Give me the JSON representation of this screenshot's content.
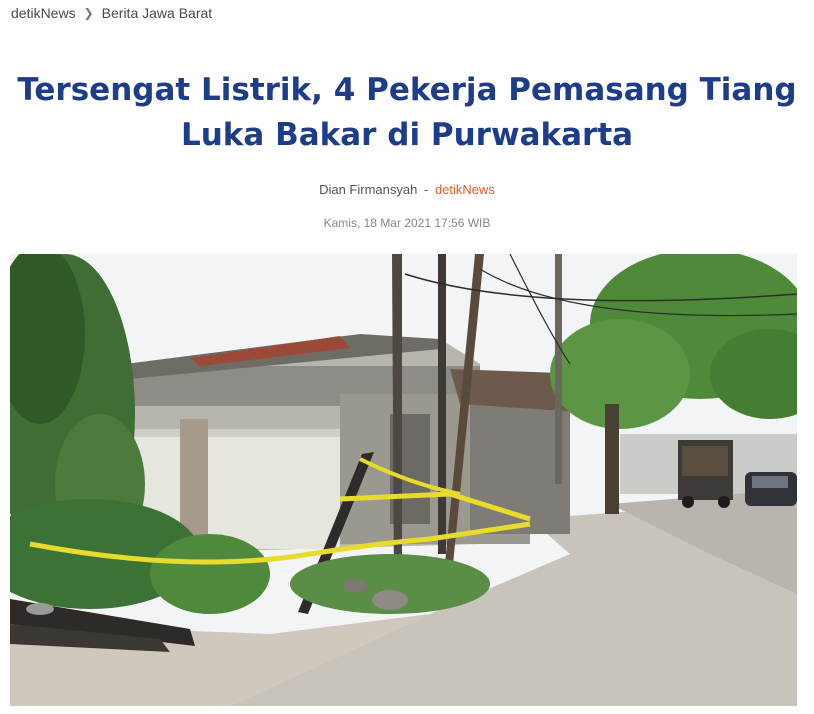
{
  "breadcrumb": {
    "items": [
      "detikNews",
      "Berita Jawa Barat"
    ],
    "separator_icon": "chevron-right-icon"
  },
  "article": {
    "title_line1": "Tersengat Listrik, 4 Pekerja Pemasang Tiang",
    "title_line2": "Luka Bakar di Purwakarta",
    "author": "Dian Firmansyah",
    "byline_separator": "-",
    "source": "detikNews",
    "date": "Kamis, 18 Mar 2021 17:56 WIB"
  },
  "colors": {
    "title": "#1d3d8a",
    "source": "#e25a29",
    "police_tape": "#e8dc2a"
  }
}
